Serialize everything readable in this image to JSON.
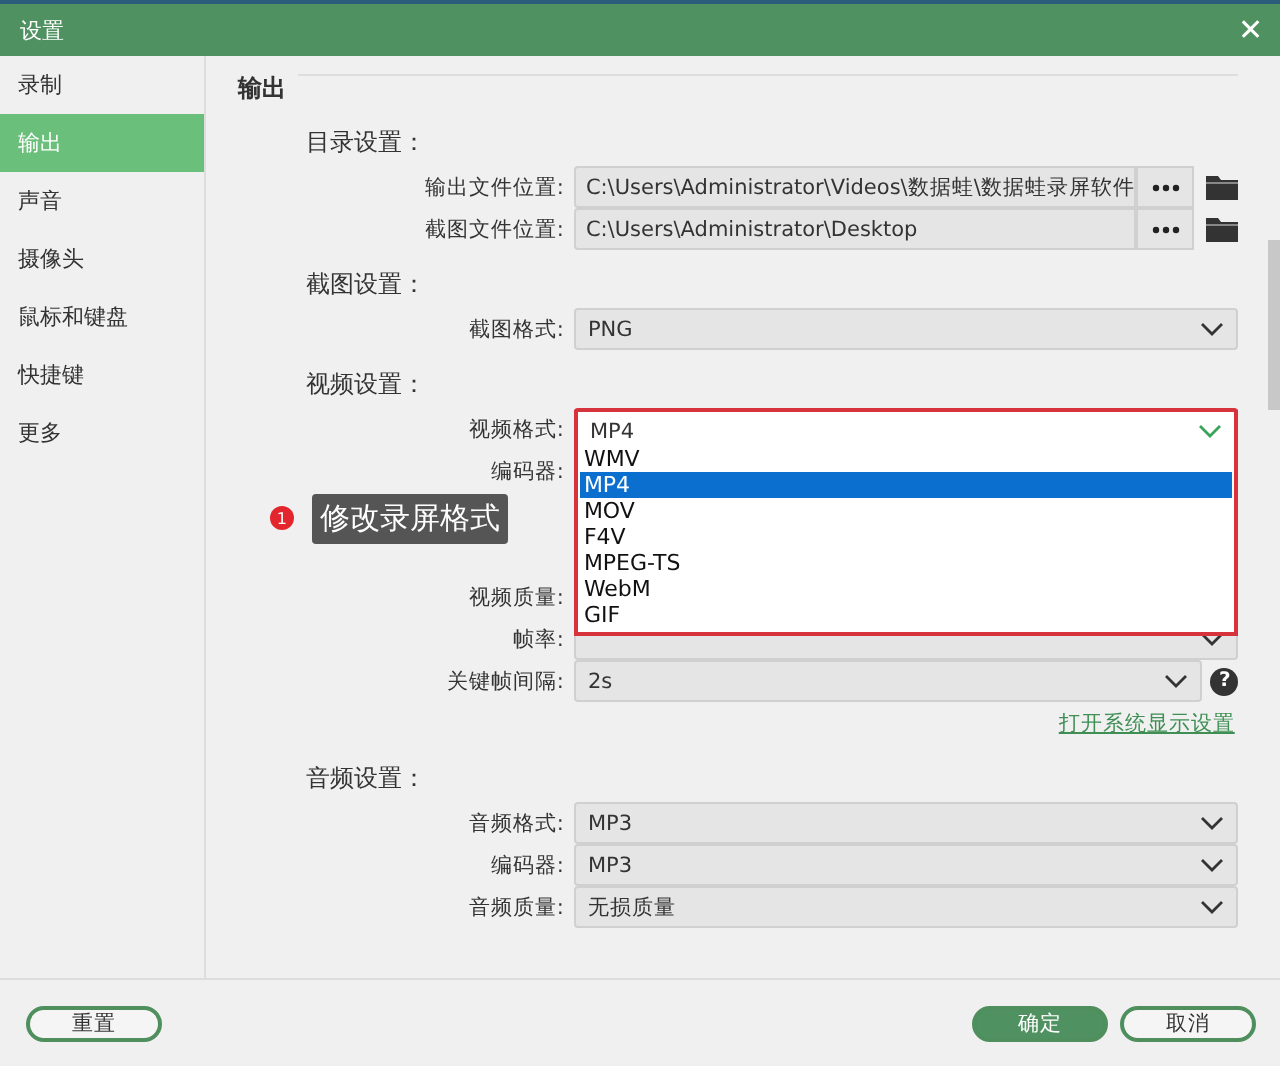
{
  "window": {
    "title": "设置",
    "close": "✕"
  },
  "sidebar": {
    "items": [
      {
        "label": "录制",
        "selected": false
      },
      {
        "label": "输出",
        "selected": true
      },
      {
        "label": "声音",
        "selected": false
      },
      {
        "label": "摄像头",
        "selected": false
      },
      {
        "label": "鼠标和键盘",
        "selected": false
      },
      {
        "label": "快捷键",
        "selected": false
      },
      {
        "label": "更多",
        "selected": false
      }
    ]
  },
  "section": {
    "title": "输出",
    "groups": [
      {
        "title": "目录设置：",
        "rows": [
          {
            "kind": "path",
            "label": "输出文件位置:",
            "value": "C:\\Users\\Administrator\\Videos\\数据蛙\\数据蛙录屏软件"
          },
          {
            "kind": "path",
            "label": "截图文件位置:",
            "value": "C:\\Users\\Administrator\\Desktop"
          }
        ]
      },
      {
        "title": "截图设置：",
        "rows": [
          {
            "kind": "select",
            "label": "截图格式:",
            "value": "PNG"
          }
        ]
      },
      {
        "title": "视频设置：",
        "rows": [
          {
            "kind": "open_select",
            "label": "视频格式:",
            "value": "MP4",
            "options": [
              {
                "label": "WMV",
                "selected": false
              },
              {
                "label": "MP4",
                "selected": true
              },
              {
                "label": "MOV",
                "selected": false
              },
              {
                "label": "F4V",
                "selected": false
              },
              {
                "label": "MPEG-TS",
                "selected": false
              },
              {
                "label": "WebM",
                "selected": false
              },
              {
                "label": "GIF",
                "selected": false
              }
            ]
          },
          {
            "kind": "label_only",
            "label": "编码器:"
          },
          {
            "kind": "callout",
            "badge": "1",
            "text": "修改录屏格式"
          },
          {
            "kind": "label_only",
            "label": "视频质量:"
          },
          {
            "kind": "select",
            "label": "帧率:"
          },
          {
            "kind": "select_help",
            "label": "关键帧间隔:",
            "value": "2s",
            "help": "?"
          },
          {
            "kind": "link",
            "text": "打开系统显示设置"
          }
        ]
      },
      {
        "title": "音频设置：",
        "rows": [
          {
            "kind": "select",
            "label": "音频格式:",
            "value": "MP3"
          },
          {
            "kind": "select",
            "label": "编码器:",
            "value": "MP3"
          },
          {
            "kind": "select",
            "label": "音频质量:",
            "value": "无损质量"
          }
        ]
      }
    ]
  },
  "buttons": {
    "reset": "重置",
    "ok": "确定",
    "cancel": "取消"
  }
}
